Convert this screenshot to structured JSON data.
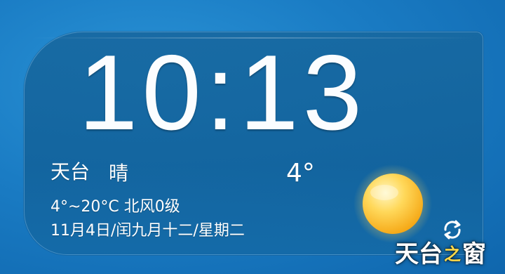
{
  "clock": {
    "time": "10:13"
  },
  "weather": {
    "location": "天台",
    "condition": "晴",
    "current_temp": "4°",
    "range_wind": "4°~20°C 北风0级",
    "date_line": "11月4日/闰九月十二/星期二",
    "icon": "sun-icon"
  },
  "watermark": {
    "text_1": "天台",
    "accent": "之",
    "text_2": "窗"
  },
  "colors": {
    "background": "#1a7cc4",
    "widget": "#1768a0",
    "text": "#ffffff",
    "sun": "#ffd23a"
  }
}
